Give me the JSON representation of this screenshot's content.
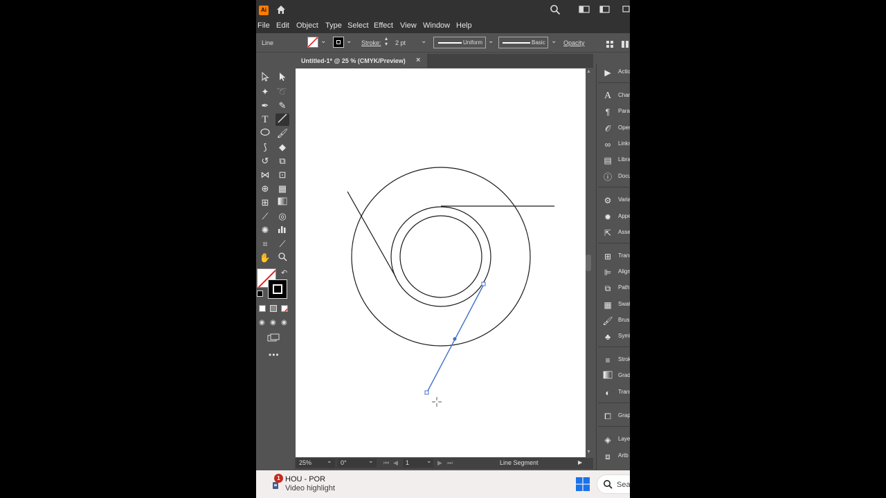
{
  "app": {
    "logo": "Ai",
    "window_icons": [
      "home-icon",
      "search-icon",
      "arrange-icon",
      "workspace-icon"
    ]
  },
  "menu": [
    "File",
    "Edit",
    "Object",
    "Type",
    "Select",
    "Effect",
    "View",
    "Window",
    "Help"
  ],
  "control_bar": {
    "selection_type": "Line",
    "stroke_label": "Stroke:",
    "stroke_weight": "2 pt",
    "profile": "Uniform",
    "brush": "Basic",
    "opacity_label": "Opacity"
  },
  "document": {
    "tab_title": "Untitled-1* @ 25 % (CMYK/Preview)",
    "close_glyph": "×"
  },
  "status_bar": {
    "zoom": "25%",
    "rotation": "0°",
    "artboard_number": "1",
    "tool_info": "Line Segment"
  },
  "right_panel": {
    "items": [
      {
        "label": "Actio",
        "icon": "play-icon"
      },
      {
        "label": "Chara",
        "icon": "character-icon"
      },
      {
        "label": "Parag",
        "icon": "paragraph-icon"
      },
      {
        "label": "Open",
        "icon": "opentype-icon"
      },
      {
        "label": "Links",
        "icon": "links-icon"
      },
      {
        "label": "Libra",
        "icon": "libraries-icon"
      },
      {
        "label": "Docu",
        "icon": "document-info-icon"
      },
      {
        "label": "Varia",
        "icon": "variables-icon"
      },
      {
        "label": "Appe",
        "icon": "appearance-icon"
      },
      {
        "label": "Asse",
        "icon": "asset-export-icon"
      },
      {
        "label": "Trans",
        "icon": "transform-icon"
      },
      {
        "label": "Align",
        "icon": "align-icon"
      },
      {
        "label": "Pathf",
        "icon": "pathfinder-icon"
      },
      {
        "label": "Swat",
        "icon": "swatches-icon"
      },
      {
        "label": "Brush",
        "icon": "brushes-icon"
      },
      {
        "label": "Symb",
        "icon": "symbols-icon"
      },
      {
        "label": "Strok",
        "icon": "stroke-icon"
      },
      {
        "label": "Grad",
        "icon": "gradient-icon"
      },
      {
        "label": "Trans",
        "icon": "transparency-icon"
      },
      {
        "label": "Grap",
        "icon": "graphic-styles-icon"
      },
      {
        "label": "Laye",
        "icon": "layers-icon"
      },
      {
        "label": "Artb",
        "icon": "artboards-icon"
      }
    ]
  },
  "taskbar": {
    "notification_count": "1",
    "title": "HOU - POR",
    "subtitle": "Video highlight",
    "search_placeholder": "Sea"
  },
  "colors": {
    "app_bg": "#535353",
    "titlebar_bg": "#323232",
    "path_selected": "#3f6fc6",
    "artboard": "#ffffff",
    "ai_logo": "#ff7c00"
  }
}
